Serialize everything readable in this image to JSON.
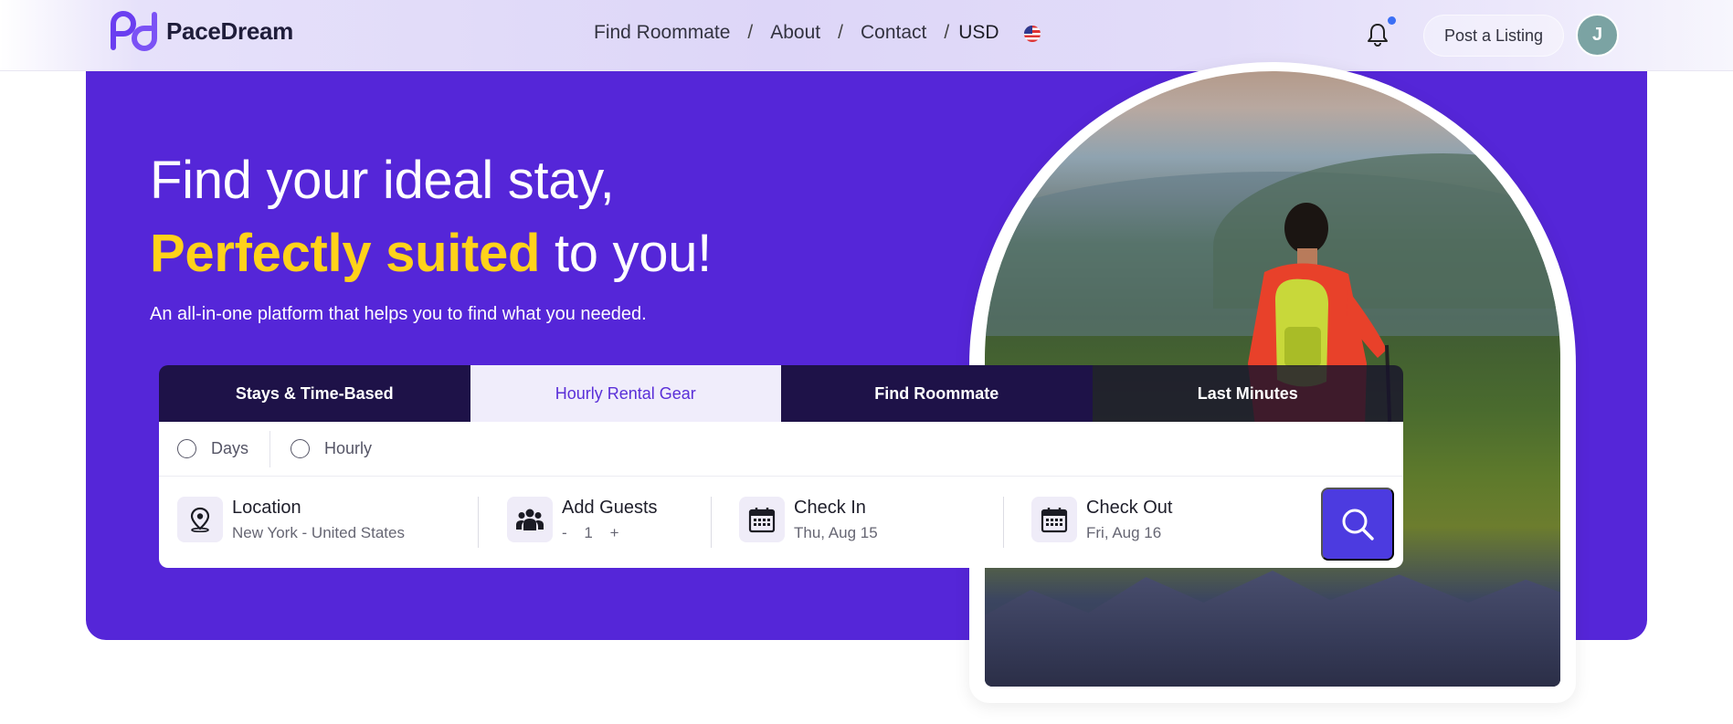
{
  "header": {
    "brand": "PaceDream",
    "nav": [
      {
        "label": "Find Roommate"
      },
      {
        "label": "About"
      },
      {
        "label": "Contact"
      }
    ],
    "separator": "/",
    "currency": "USD",
    "post_listing": "Post a Listing",
    "avatar_initial": "J"
  },
  "hero": {
    "line1": "Find your ideal stay,",
    "highlight": "Perfectly suited",
    "line2_rest": " to you!",
    "subtitle": "An all-in-one platform that helps you to find what you needed."
  },
  "search": {
    "tabs": [
      {
        "label": "Stays & Time-Based"
      },
      {
        "label": "Hourly Rental Gear"
      },
      {
        "label": "Find Roommate"
      },
      {
        "label": "Last Minutes"
      }
    ],
    "active_tab": 1,
    "radios": [
      {
        "label": "Days"
      },
      {
        "label": "Hourly"
      }
    ],
    "location": {
      "label": "Location",
      "value": "New York - United States"
    },
    "guests": {
      "label": "Add Guests",
      "minus": "-",
      "count": "1",
      "plus": "+"
    },
    "check_in": {
      "label": "Check In",
      "value": "Thu, Aug 15"
    },
    "check_out": {
      "label": "Check Out",
      "value": "Fri, Aug 16"
    }
  },
  "colors": {
    "brand_purple": "#5526d8",
    "highlight_yellow": "#ffd21a",
    "search_button": "#4c3be0",
    "tab_dark": "#1e1248"
  },
  "icons": [
    "logo-icon",
    "flag-us-icon",
    "bell-icon",
    "location-pin-icon",
    "users-icon",
    "calendar-icon",
    "search-icon"
  ]
}
